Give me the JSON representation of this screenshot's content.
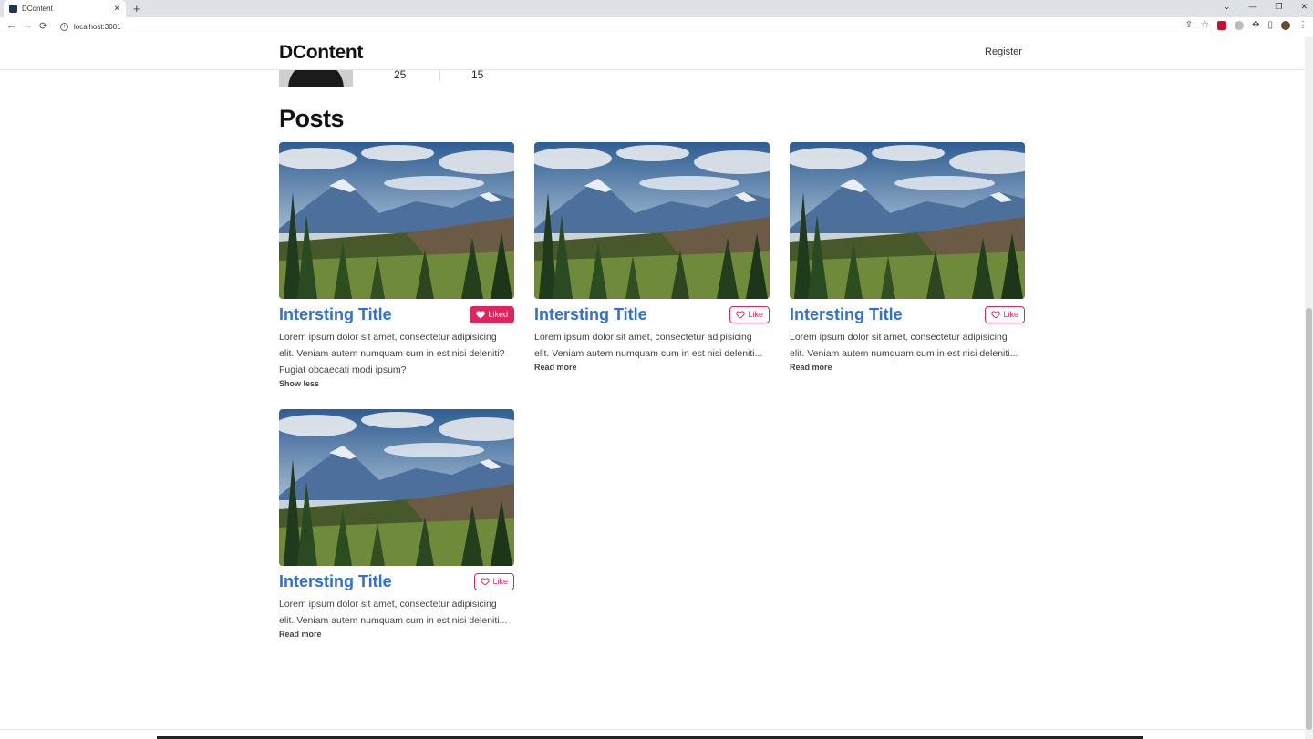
{
  "browser": {
    "tab_title": "DContent",
    "tab_close": "✕",
    "new_tab": "+",
    "url": "localhost:3001",
    "back": "←",
    "forward": "→",
    "reload": "⟳",
    "minimize": "—",
    "restore": "❐",
    "close": "✕"
  },
  "header": {
    "brand": "DContent",
    "register": "Register"
  },
  "profile": {
    "stat_one": "25",
    "stat_two": "15"
  },
  "posts_heading": "Posts",
  "posts": [
    {
      "title": "Intersting Title",
      "like_label": "Liked",
      "liked": true,
      "text_lines": [
        "Lorem ipsum dolor sit amet, consectetur adipisicing",
        "elit. Veniam autem numquam cum in est nisi deleniti?",
        "Fugiat obcaecati modi ipsum?"
      ],
      "link": "Show less"
    },
    {
      "title": "Intersting Title",
      "like_label": "Like",
      "liked": false,
      "text_lines": [
        "Lorem ipsum dolor sit amet, consectetur adipisicing",
        "elit. Veniam autem numquam cum in est nisi deleniti..."
      ],
      "link": "Read more"
    },
    {
      "title": "Intersting Title",
      "like_label": "Like",
      "liked": false,
      "text_lines": [
        "Lorem ipsum dolor sit amet, consectetur adipisicing",
        "elit. Veniam autem numquam cum in est nisi deleniti..."
      ],
      "link": "Read more"
    },
    {
      "title": "Intersting Title",
      "like_label": "Like",
      "liked": false,
      "text_lines": [
        "Lorem ipsum dolor sit amet, consectetur adipisicing",
        "elit. Veniam autem numquam cum in est nisi deleniti..."
      ],
      "link": "Read more"
    }
  ],
  "colors": {
    "title_blue": "#2f6fd6",
    "like_pink": "#e0245e"
  },
  "icons": {
    "heart": "heart-icon",
    "info": "info-icon",
    "photo": "mountain-landscape-image"
  }
}
